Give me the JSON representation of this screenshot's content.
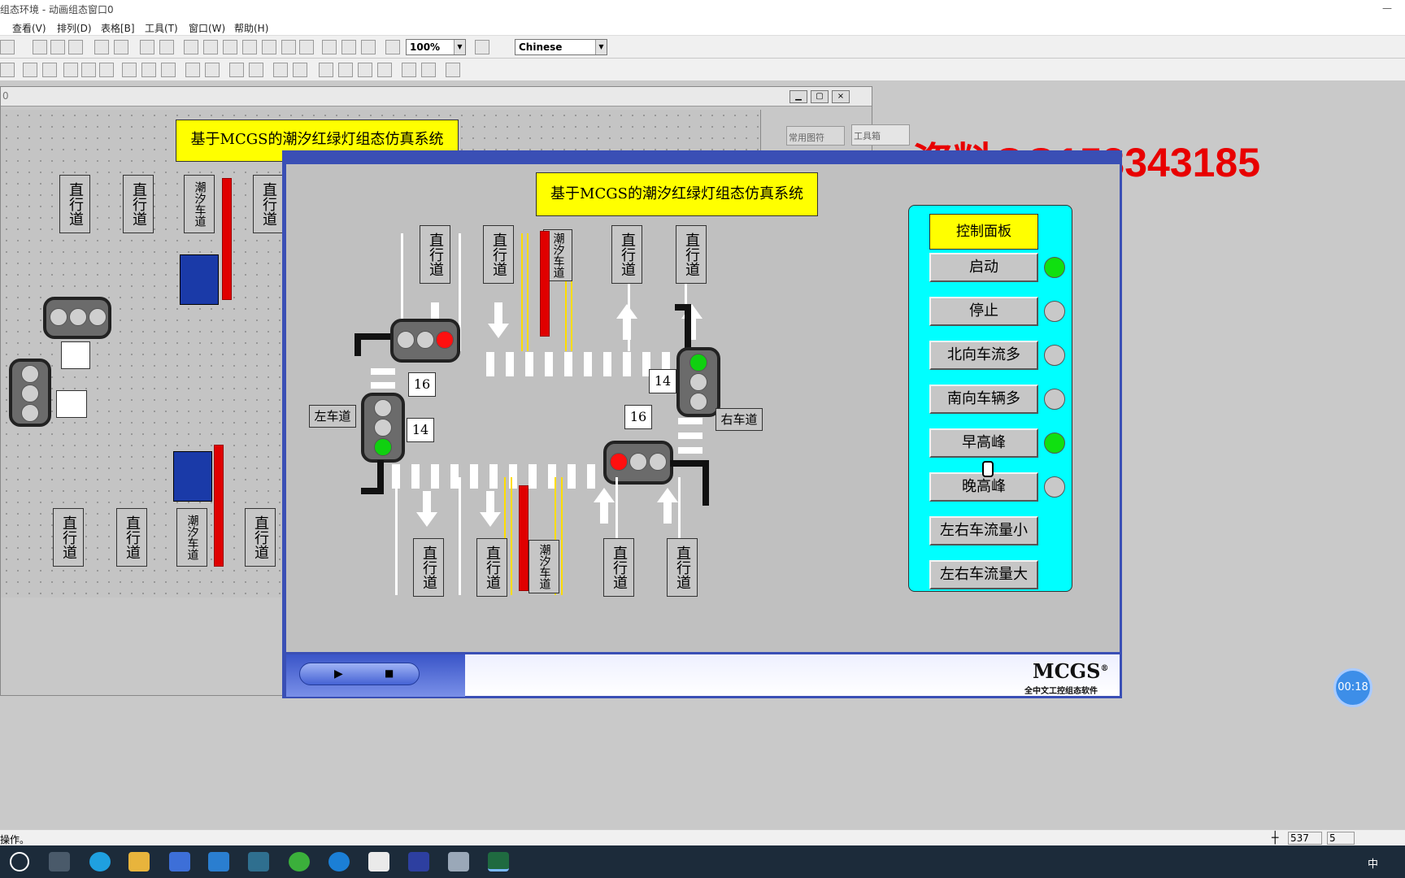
{
  "window": {
    "title": "组态环境 - 动画组态窗口0",
    "close_glyph": "×"
  },
  "menu": [
    "查看(V)",
    "排列(D)",
    "表格[B]",
    "工具(T)",
    "窗口(W)",
    "帮助(H)"
  ],
  "toolbar": {
    "zoom": "100%",
    "language": "Chinese"
  },
  "back_window": {
    "title_fragment": "0",
    "tab_symbols": "常用图符",
    "tab_toolbox": "工具箱"
  },
  "watermark": "资料QQ153343185",
  "scene": {
    "title": "基于MCGS的潮汐红绿灯组态仿真系统",
    "lane_straight": "直行道",
    "lane_tidal": "潮汐车道",
    "left_lane": "左车道",
    "right_lane": "右车道",
    "timers": {
      "north": "16",
      "west": "14",
      "east": "14",
      "south": "16"
    }
  },
  "control_panel": {
    "title": "控制面板",
    "buttons": [
      {
        "label": "启动",
        "indicator": "on"
      },
      {
        "label": "停止",
        "indicator": "off"
      },
      {
        "label": "北向车流多",
        "indicator": "off"
      },
      {
        "label": "南向车辆多",
        "indicator": "off"
      },
      {
        "label": "早高峰",
        "indicator": "on"
      },
      {
        "label": "晚高峰",
        "indicator": "off"
      },
      {
        "label": "左右车流量小",
        "indicator": "none"
      },
      {
        "label": "左右车流量大",
        "indicator": "none"
      }
    ]
  },
  "player": {
    "brand": "MCGS",
    "brand_mark": "®",
    "brand_sub": "全中文工控组态软件",
    "play_glyph": "▶",
    "stop_glyph": "■"
  },
  "recording_timer": "00:18",
  "status": {
    "text": "操作。",
    "x": "537",
    "y": "5"
  },
  "taskbar": {
    "ime": "中"
  }
}
